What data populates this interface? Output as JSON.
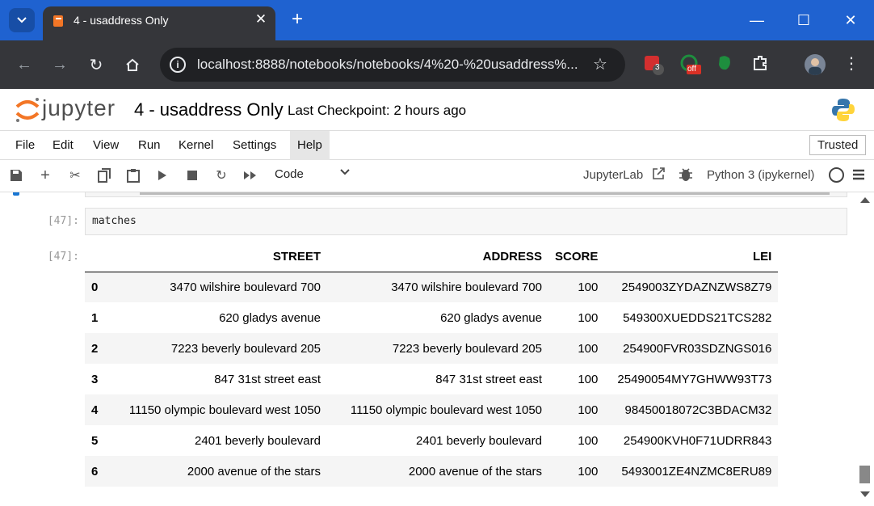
{
  "browser": {
    "tab_title": "4 - usaddress Only",
    "url": "localhost:8888/notebooks/notebooks/4%20-%20usaddress%...",
    "ext_badge_count": "3",
    "ext_badge_off": "off"
  },
  "jupyter": {
    "logo_text": "jupyter",
    "notebook_title": "4 - usaddress Only",
    "checkpoint": "Last Checkpoint: 2 hours ago",
    "menu": [
      "File",
      "Edit",
      "View",
      "Run",
      "Kernel",
      "Settings",
      "Help"
    ],
    "trusted": "Trusted",
    "cell_type": "Code",
    "jupyterlab_label": "JupyterLab",
    "kernel": "Python 3 (ipykernel)"
  },
  "cell": {
    "in_prompt": "[47]:",
    "out_prompt": "[47]:",
    "code": "matches"
  },
  "table": {
    "columns": [
      "",
      "STREET",
      "ADDRESS",
      "SCORE",
      "LEI"
    ],
    "rows": [
      [
        "0",
        "3470 wilshire boulevard 700",
        "3470 wilshire boulevard 700",
        "100",
        "2549003ZYDAZNZWS8Z79"
      ],
      [
        "1",
        "620 gladys avenue",
        "620 gladys avenue",
        "100",
        "549300XUEDDS21TCS282"
      ],
      [
        "2",
        "7223 beverly boulevard 205",
        "7223 beverly boulevard 205",
        "100",
        "254900FVR03SDZNGS016"
      ],
      [
        "3",
        "847 31st street east",
        "847 31st street east",
        "100",
        "25490054MY7GHWW93T73"
      ],
      [
        "4",
        "11150 olympic boulevard west 1050",
        "11150 olympic boulevard west 1050",
        "100",
        "98450018072C3BDACM32"
      ],
      [
        "5",
        "2401 beverly boulevard",
        "2401 beverly boulevard",
        "100",
        "254900KVH0F71UDRR843"
      ],
      [
        "6",
        "2000 avenue of the stars",
        "2000 avenue of the stars",
        "100",
        "5493001ZE4NZMC8ERU89"
      ]
    ]
  }
}
